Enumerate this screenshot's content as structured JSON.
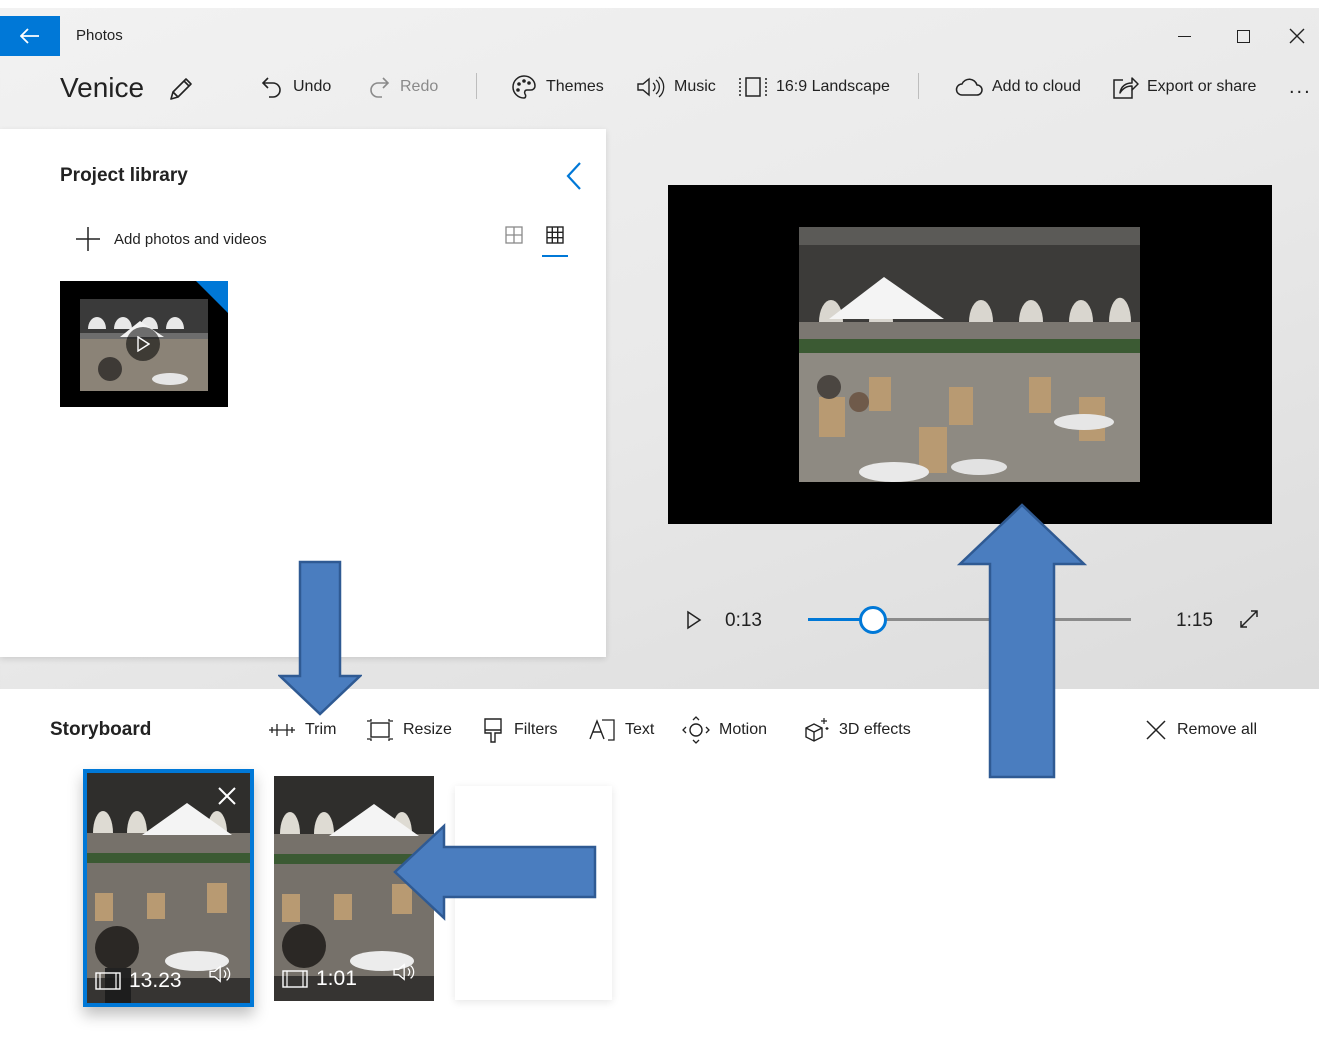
{
  "window": {
    "app_title": "Photos",
    "back_icon": "back-arrow-icon",
    "accent": "#0078d7"
  },
  "toolbar": {
    "project_title": "Venice",
    "undo": "Undo",
    "redo": "Redo",
    "themes": "Themes",
    "music": "Music",
    "aspect": "16:9 Landscape",
    "add_to_cloud": "Add to cloud",
    "export_share": "Export or share",
    "more": "..."
  },
  "library": {
    "title": "Project library",
    "add_label": "Add photos and videos"
  },
  "player": {
    "current_time": "0:13",
    "total_time": "1:15",
    "progress": 0.2
  },
  "storyboard": {
    "title": "Storyboard",
    "tools": {
      "trim": "Trim",
      "resize": "Resize",
      "filters": "Filters",
      "text": "Text",
      "motion": "Motion",
      "effects_3d": "3D effects",
      "remove_all": "Remove all"
    },
    "clips": [
      {
        "duration": "13.23",
        "selected": true
      },
      {
        "duration": "1:01",
        "selected": false
      }
    ]
  },
  "annotation_color": "#4a7dbf"
}
